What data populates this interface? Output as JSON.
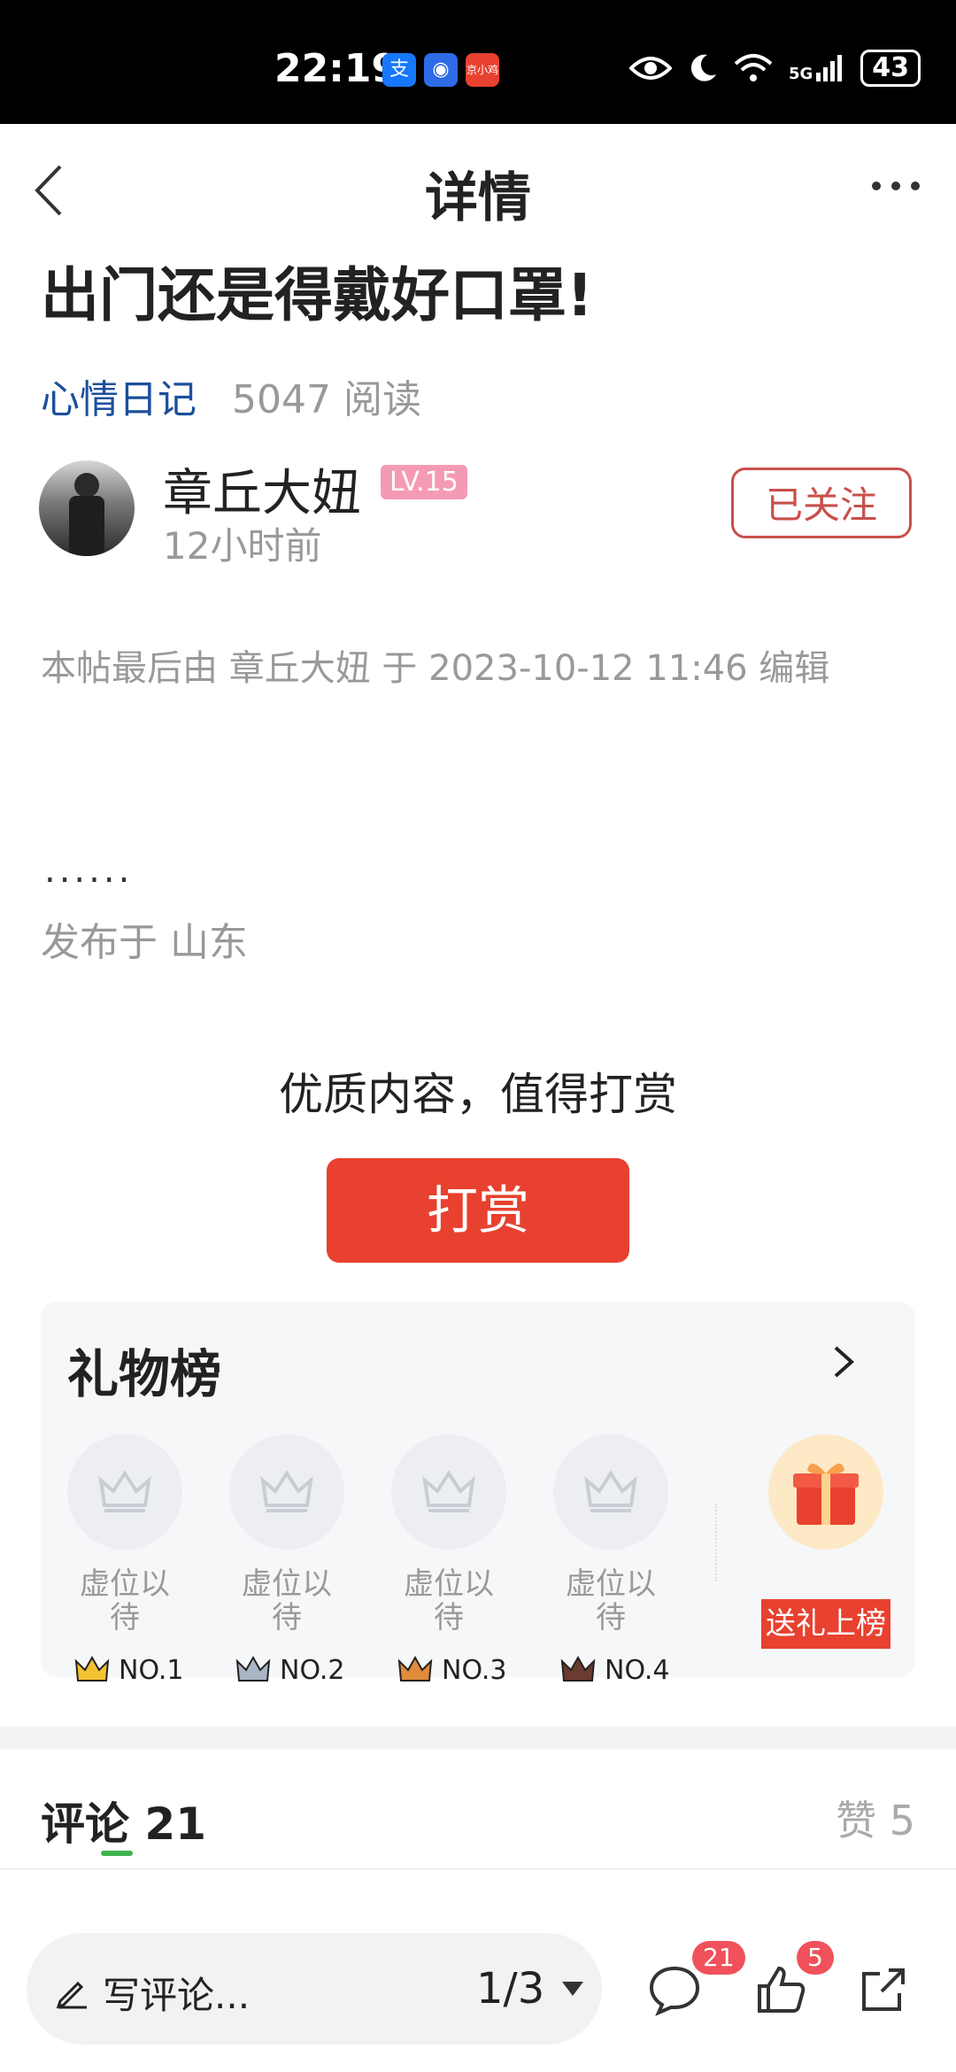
{
  "status_bar": {
    "time": "22:19",
    "apps": [
      {
        "name": "alipay-icon",
        "label": "支",
        "color": "#1677ff"
      },
      {
        "name": "app-blue-icon",
        "label": "◉",
        "color": "#2e6be6"
      },
      {
        "name": "app-red-icon",
        "label": "京小鸡",
        "color": "#e8412f"
      }
    ],
    "network": "5G",
    "battery": "43"
  },
  "nav": {
    "title": "详情"
  },
  "post": {
    "title": "出门还是得戴好口罩!",
    "category": "心情日记",
    "reads": "5047 阅读",
    "author": "章丘大妞",
    "level": "LV.15",
    "time_ago": "12小时前",
    "follow_label": "已关注",
    "edit_note": "本帖最后由 章丘大妞 于 2023-10-12 11:46 编辑",
    "body_dots": "......",
    "published": "发布于 山东"
  },
  "reward": {
    "prompt": "优质内容，值得打赏",
    "button": "打赏"
  },
  "gift_board": {
    "title": "礼物榜",
    "seats": [
      {
        "label_line1": "虚位以",
        "label_line2": "待",
        "rank": "NO.1",
        "crown_color": "#f2c230"
      },
      {
        "label_line1": "虚位以",
        "label_line2": "待",
        "rank": "NO.2",
        "crown_color": "#a9b6c4"
      },
      {
        "label_line1": "虚位以",
        "label_line2": "待",
        "rank": "NO.3",
        "crown_color": "#e08a3c"
      },
      {
        "label_line1": "虚位以",
        "label_line2": "待",
        "rank": "NO.4",
        "crown_color": "#6b3b2e"
      }
    ],
    "send_button": "送礼上榜"
  },
  "tabs": {
    "comments": "评论 21",
    "likes": "赞 5"
  },
  "bottom_bar": {
    "placeholder": "写评论...",
    "page": "1/3",
    "comment_count": "21",
    "like_count": "5"
  }
}
